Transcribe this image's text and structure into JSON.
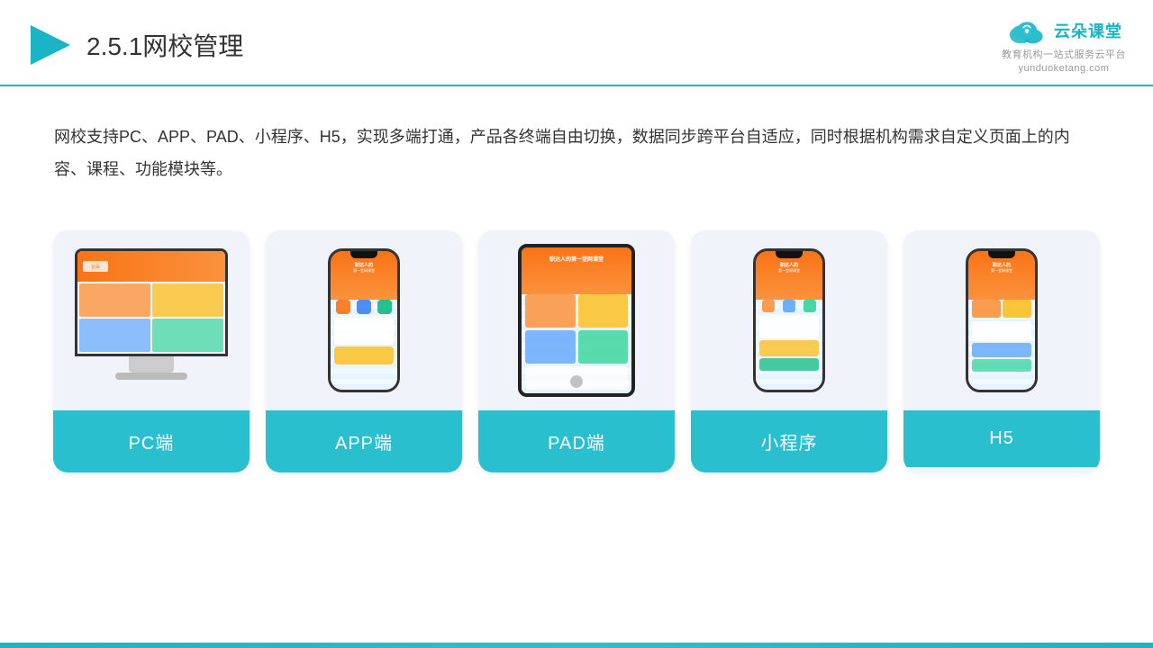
{
  "header": {
    "title_number": "2.5.1",
    "title_text": "网校管理",
    "logo_main": "云朵课堂",
    "logo_url": "yunduoketang.com",
    "logo_sub": "教育机构一站\n式服务云平台"
  },
  "description": {
    "text": "网校支持PC、APP、PAD、小程序、H5，实现多端打通，产品各终端自由切换，数据同步跨平台自适应，同时根据机构需求自定义页面上的内容、课程、功能模块等。"
  },
  "cards": [
    {
      "id": "pc",
      "label": "PC端",
      "type": "monitor"
    },
    {
      "id": "app",
      "label": "APP端",
      "type": "phone"
    },
    {
      "id": "pad",
      "label": "PAD端",
      "type": "tablet"
    },
    {
      "id": "mini",
      "label": "小程序",
      "type": "phone"
    },
    {
      "id": "h5",
      "label": "H5",
      "type": "phone"
    }
  ],
  "brand_color": "#1ab5c5"
}
